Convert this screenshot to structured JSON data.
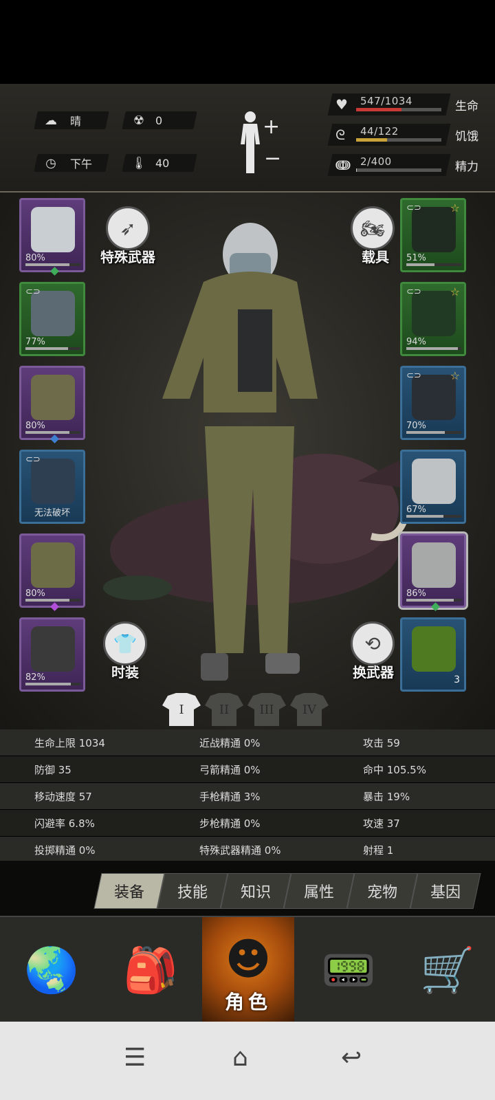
{
  "header": {
    "weather": {
      "icon": "cloud-icon",
      "label": "晴"
    },
    "radiation": {
      "icon": "radiation-icon",
      "value": "0"
    },
    "time": {
      "icon": "clock-icon",
      "label": "下午"
    },
    "temperature": {
      "icon": "thermometer-icon",
      "value": "40"
    },
    "health": {
      "text": "547/1034",
      "label": "生命",
      "fraction": 0.529,
      "color": "#c73a36"
    },
    "hunger": {
      "text": "44/122",
      "label": "饥饿",
      "fraction": 0.361,
      "color": "#caa23a"
    },
    "energy": {
      "text": "2/400",
      "label": "精力",
      "fraction": 0.005,
      "color": "#c8c8c8"
    }
  },
  "scene": {
    "special_weapon_label": "特殊武器",
    "vehicle_label": "载具",
    "fashion_label": "时装",
    "swap_weapon_label": "换武器",
    "left_slots": [
      {
        "name": "helmet",
        "pct": "80%",
        "durability": 0.8,
        "rarity": "purple",
        "gem": "#3fae5a"
      },
      {
        "name": "shirt",
        "pct": "77%",
        "durability": 0.77,
        "rarity": "green"
      },
      {
        "name": "jacket",
        "pct": "80%",
        "durability": 0.8,
        "rarity": "purple",
        "gem": "#3f7fd0"
      },
      {
        "name": "backpack",
        "text": "无法破坏",
        "rarity": "blue"
      },
      {
        "name": "pants",
        "pct": "80%",
        "durability": 0.8,
        "rarity": "purple",
        "gem": "#b14fd8"
      },
      {
        "name": "boots",
        "pct": "82%",
        "durability": 0.82,
        "rarity": "purple"
      }
    ],
    "right_slots": [
      {
        "name": "glasses",
        "pct": "51%",
        "durability": 0.51,
        "rarity": "green"
      },
      {
        "name": "mask",
        "pct": "94%",
        "durability": 0.94,
        "rarity": "green"
      },
      {
        "name": "vest",
        "pct": "70%",
        "durability": 0.7,
        "rarity": "blue"
      },
      {
        "name": "shield",
        "pct": "67%",
        "durability": 0.67,
        "rarity": "blue"
      },
      {
        "name": "machete",
        "pct": "86%",
        "durability": 0.86,
        "rarity": "purple",
        "gem": "#3fae5a"
      },
      {
        "name": "molotov",
        "count": "3",
        "rarity": "blue"
      }
    ],
    "outfit_tabs": [
      "I",
      "II",
      "III",
      "IV"
    ]
  },
  "stats": [
    [
      "生命上限 1034",
      "近战精通 0%",
      "攻击 59"
    ],
    [
      "防御 35",
      "弓箭精通 0%",
      "命中 105.5%"
    ],
    [
      "移动速度 57",
      "手枪精通 3%",
      "暴击 19%"
    ],
    [
      "闪避率 6.8%",
      "步枪精通 0%",
      "攻速 37"
    ],
    [
      "投掷精通 0%",
      "特殊武器精通 0%",
      "射程 1"
    ]
  ],
  "tabs": [
    "装备",
    "技能",
    "知识",
    "属性",
    "宠物",
    "基因"
  ],
  "bottom_nav": {
    "world": "globe-icon",
    "backpack": "backpack-icon",
    "character_label": "角色",
    "radio": "walkie-talkie-icon",
    "shop": "cart-icon"
  }
}
